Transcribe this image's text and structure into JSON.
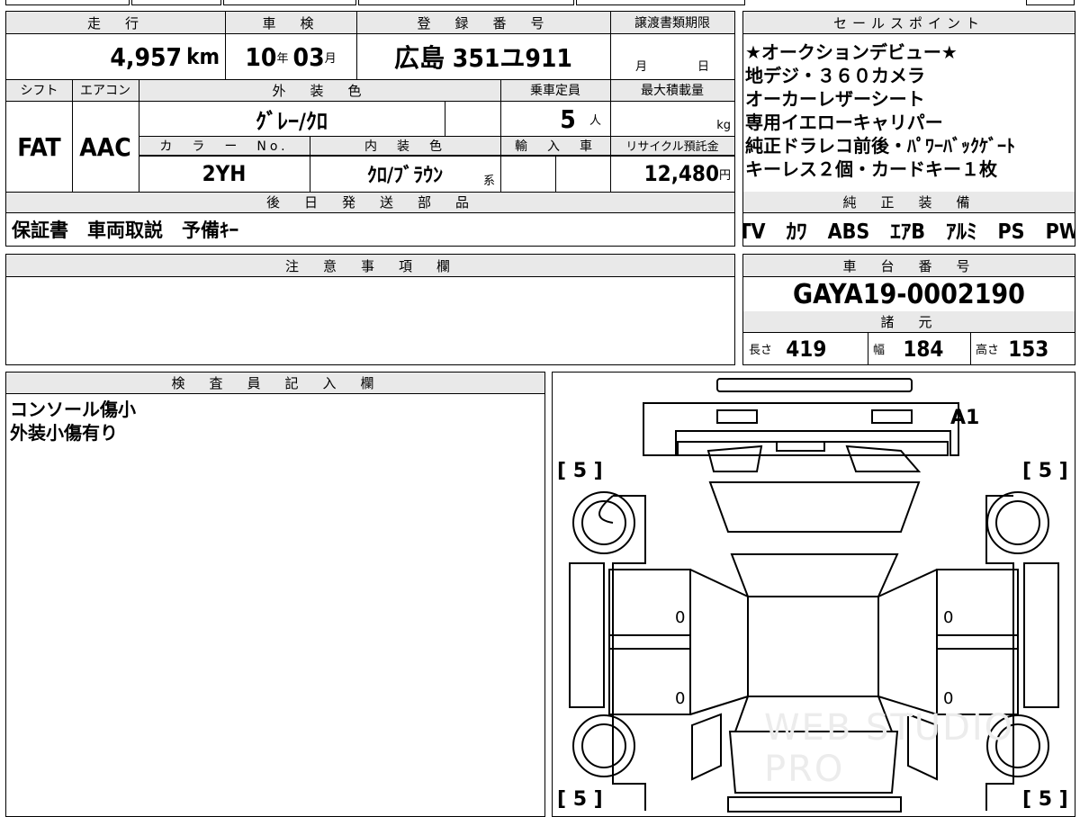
{
  "headers": {
    "mileage": "走　行",
    "inspection": "車　検",
    "registration": "登　録　番　号",
    "transfer_deadline": "譲渡書類期限",
    "sales_points": "セールスポイント",
    "shift": "シフト",
    "aircon": "エアコン",
    "exterior_color": "外　装　色",
    "capacity": "乗車定員",
    "max_load": "最大積載量",
    "color_no": "カ　ラ　ー　No.",
    "interior_color": "内　装　色",
    "import": "輸　入　車",
    "recycle": "リサイクル預託金",
    "later_parts": "後　日　発　送　部　品",
    "factory_equipment": "純　正　装　備",
    "notes": "注　意　事　項　欄",
    "chassis_no": "車　台　番　号",
    "specs": "諸　元",
    "inspector": "検　査　員　記　入　欄"
  },
  "values": {
    "mileage": "4,957",
    "mileage_unit": "km",
    "inspection_year": "10",
    "year_unit": "年",
    "inspection_month": "03",
    "month_unit": "月",
    "registration": "広島 351ユ911",
    "deadline_month": "月",
    "deadline_day": "日",
    "shift": "FAT",
    "aircon": "AAC",
    "exterior_color": "ｸﾞﾚｰ/ｸﾛ",
    "capacity": "5",
    "capacity_unit": "人",
    "load_unit": "kg",
    "color_no": "2YH",
    "interior_color": "ｸﾛ/ﾌﾞﾗｳﾝ",
    "interior_suffix": "系",
    "recycle": "12,480",
    "recycle_unit": "円",
    "later_parts": "保証書　車両取説　予備ｷｰ",
    "factory_equipment": "TV　ｶﾜ　ABS　ｴｱB　ｱﾙﾐ　PS　PW",
    "chassis_no": "GAYA19-0002190",
    "length_label": "長さ",
    "length": "419",
    "width_label": "幅",
    "width": "184",
    "height_label": "高さ",
    "height": "153"
  },
  "sales_points": [
    "★オークションデビュー★",
    "地デジ・３６０カメラ",
    "オーカーレザーシート",
    "専用イエローキャリパー",
    "純正ドラレコ前後・ﾊﾟﾜｰﾊﾞｯｸｹﾞｰﾄ",
    "キーレス２個・カードキー１枚"
  ],
  "inspector_notes": [
    "コンソール傷小",
    "外装小傷有り"
  ],
  "diagram": {
    "tread_fl": "[ 5 ]",
    "tread_fr": "[ 5 ]",
    "tread_rl": "[ 5 ]",
    "tread_rr": "[ 5 ]",
    "mark_a1": "A1",
    "door_fl": "0",
    "door_rl": "0",
    "door_fr": "0",
    "door_rr": "0",
    "watermark": "WEB STUDIO PRO"
  }
}
